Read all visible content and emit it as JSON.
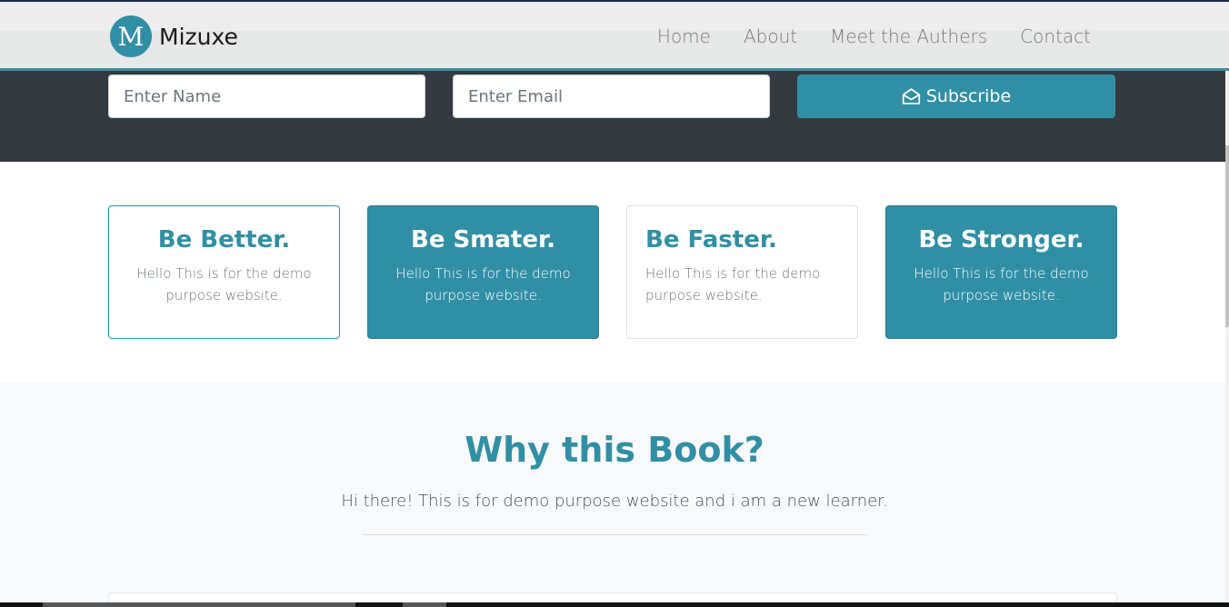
{
  "brand": {
    "logo_letter": "M",
    "name": "Mizuxe"
  },
  "nav": {
    "items": [
      "Home",
      "About",
      "Meet the Authers",
      "Contact"
    ]
  },
  "subscribe_form": {
    "name_placeholder": "Enter Name",
    "email_placeholder": "Enter Email",
    "button_label": "Subscribe"
  },
  "features": [
    {
      "title": "Be Better.",
      "text": "Hello This is for the demo purpose website."
    },
    {
      "title": "Be Smater.",
      "text": "Hello This is for the demo purpose website."
    },
    {
      "title": "Be Faster.",
      "text": "Hello This is for the demo purpose website."
    },
    {
      "title": "Be Stronger.",
      "text": "Hello This is for the demo purpose website."
    }
  ],
  "why": {
    "title": "Why this Book?",
    "text": "Hi there! This is for demo purpose website and i am a new learner."
  },
  "colors": {
    "accent": "#318fa5",
    "dark": "#343a40",
    "light": "#f8f9fa"
  }
}
